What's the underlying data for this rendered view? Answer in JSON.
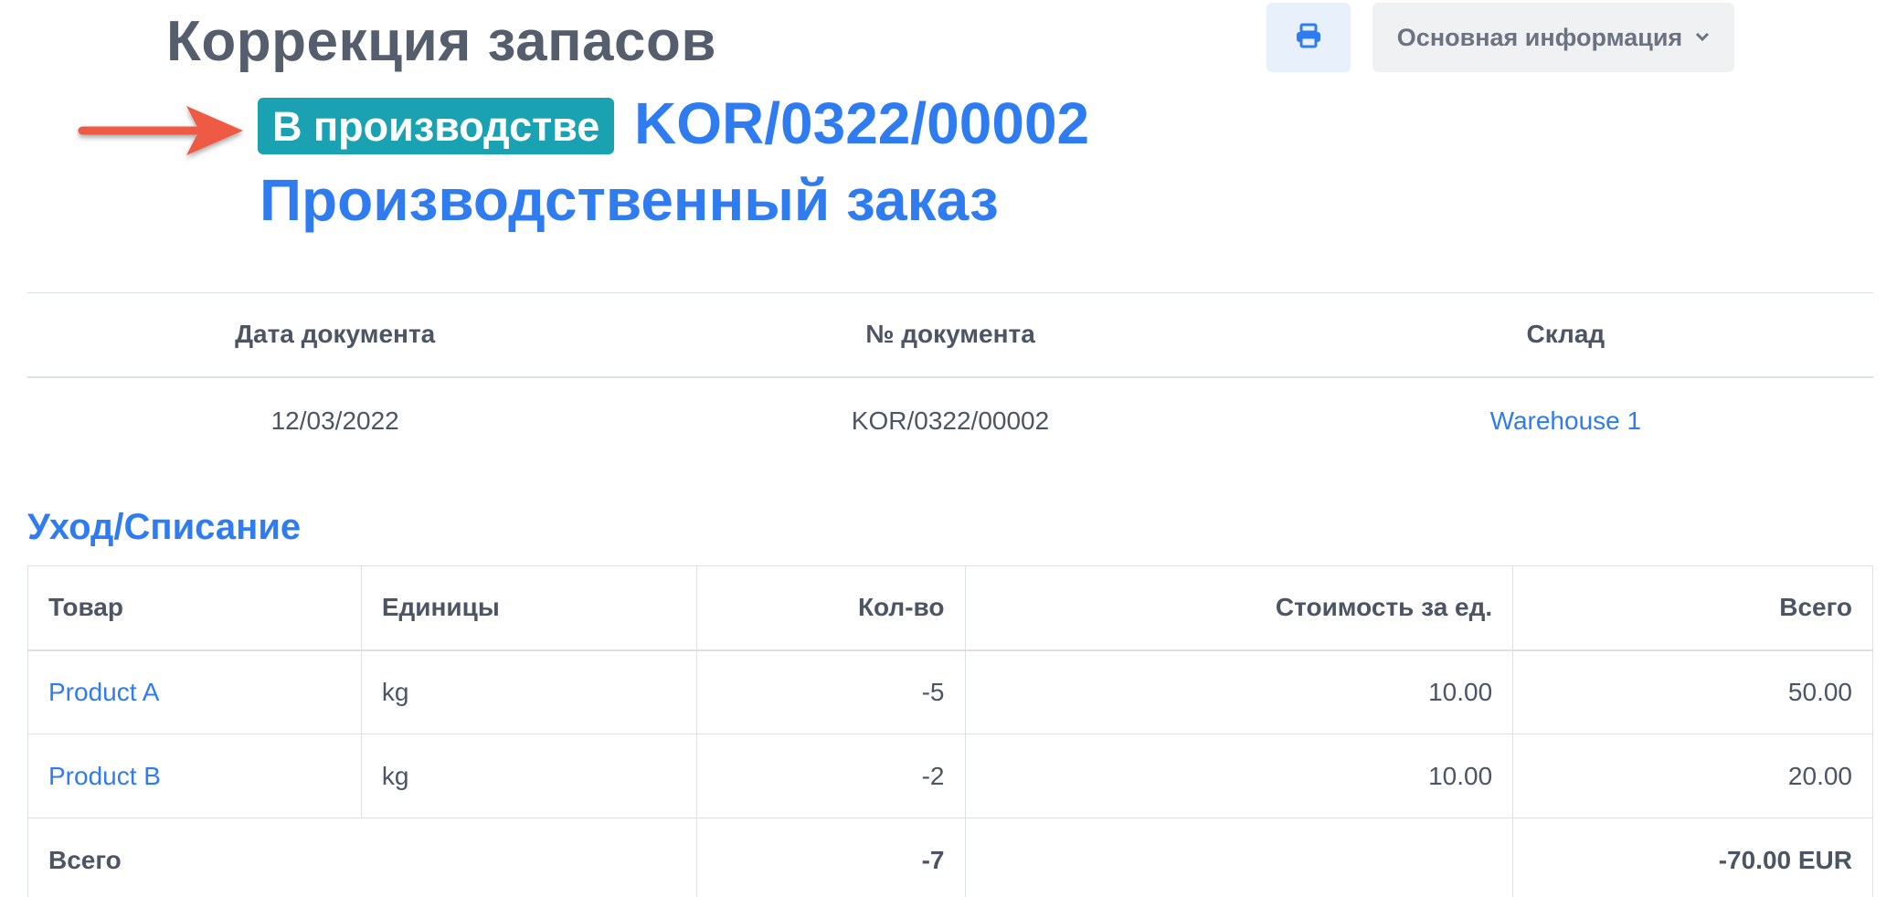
{
  "header": {
    "title": "Коррекция запасов",
    "print_icon": "printer-icon",
    "info_dropdown_label": "Основная информация",
    "info_dropdown_icon": "chevron-down-icon"
  },
  "status": {
    "badge": "В производстве",
    "badge_color": "#1aa2b2",
    "document_number": "KOR/0322/00002",
    "linked_document": "Производственный заказ"
  },
  "annotation": {
    "icon": "arrow-right-icon",
    "color": "#ef5a45"
  },
  "info": {
    "headers": [
      "Дата документа",
      "№ документа",
      "Склад"
    ],
    "values": [
      "12/03/2022",
      "KOR/0322/00002",
      "Warehouse 1"
    ]
  },
  "section": {
    "title": "Уход/Списание"
  },
  "items": {
    "headers": [
      "Товар",
      "Единицы",
      "Кол-во",
      "Стоимость за ед.",
      "Всего"
    ],
    "rows": [
      [
        "Product A",
        "kg",
        "-5",
        "10.00",
        "50.00"
      ],
      [
        "Product B",
        "kg",
        "-2",
        "10.00",
        "20.00"
      ]
    ],
    "total": {
      "label": "Всего",
      "qty": "-7",
      "amount": "-70.00 EUR"
    }
  },
  "colors": {
    "accent": "#2f7cf0",
    "title": "#545e6d"
  }
}
